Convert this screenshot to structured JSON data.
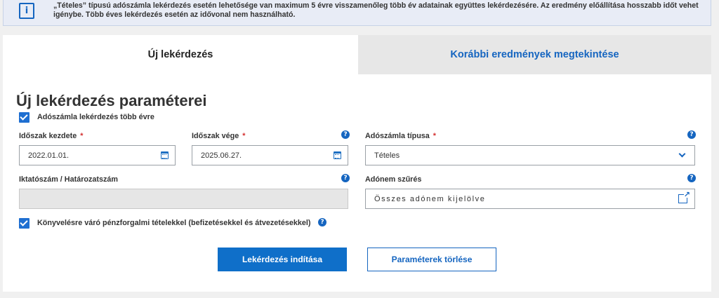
{
  "notice": {
    "icon": "info-icon",
    "icon_glyph": "i",
    "text": "„Tételes” típusú adószámla lekérdezés esetén lehetősége van maximum 5 évre visszamenőleg több év adatainak együttes lekérdezésére. Az eredmény előállítása hosszabb időt vehet igénybe. Több éves lekérdezés esetén az idővonal nem használható."
  },
  "tabs": [
    {
      "label": "Új lekérdezés",
      "active": true
    },
    {
      "label": "Korábbi eredmények megtekintése",
      "active": false
    }
  ],
  "form": {
    "title": "Új lekérdezés paraméterei",
    "multi_year": {
      "label": "Adószámla lekérdezés több évre",
      "checked": true
    },
    "period_start": {
      "label": "Időszak kezdete",
      "required_mark": "*",
      "value": "2022.01.01."
    },
    "period_end": {
      "label": "Időszak vége",
      "required_mark": "*",
      "value": "2025.06.27."
    },
    "account_type": {
      "label": "Adószámla típusa",
      "required_mark": "*",
      "value": "Tételes"
    },
    "reference_number": {
      "label": "Iktatószám / Határozatszám",
      "value": ""
    },
    "tax_filter": {
      "label": "Adónem szűrés",
      "value": "Összes adónem kijelölve"
    },
    "pending_items": {
      "label": "Könyvelésre váró pénzforgalmi tételekkel (befizetésekkel és átvezetésekkel)",
      "checked": true
    },
    "help_glyph": "?"
  },
  "buttons": {
    "submit": "Lekérdezés indítása",
    "reset": "Paraméterek törlése"
  },
  "colors": {
    "accent": "#1565c0",
    "primary_button": "#0f6fc9",
    "required": "#d32f2f",
    "notice_bg": "#e8ecf6"
  }
}
